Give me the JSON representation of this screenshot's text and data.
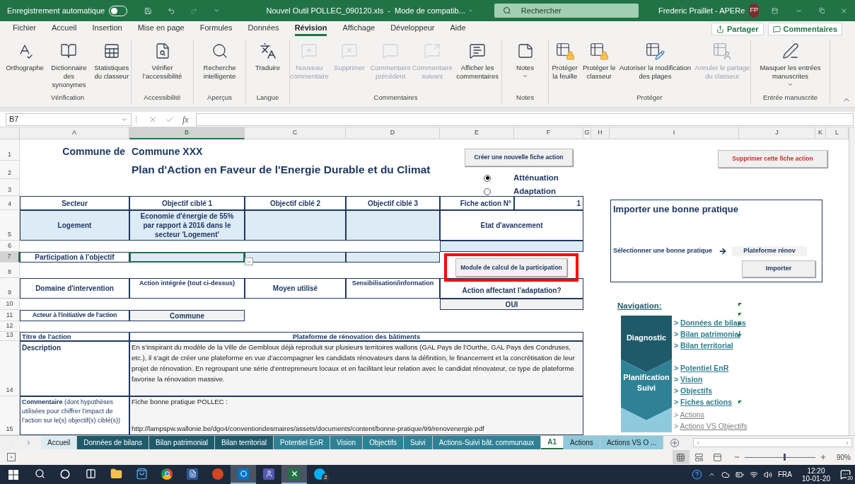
{
  "title_bar": {
    "autosave_label": "Enregistrement automatique",
    "autosave_on": false,
    "document_title": "Nouvel Outil POLLEC_090120.xls  -  Mode de compatib...",
    "search_placeholder": "Rechercher",
    "user_name": "Frederic Praillet - APERe",
    "user_initials": "FP"
  },
  "menu_tabs": [
    {
      "label": "Fichier",
      "selected": false
    },
    {
      "label": "Accueil",
      "selected": false
    },
    {
      "label": "Insertion",
      "selected": false
    },
    {
      "label": "Mise en page",
      "selected": false
    },
    {
      "label": "Formules",
      "selected": false
    },
    {
      "label": "Données",
      "selected": false
    },
    {
      "label": "Révision",
      "selected": true
    },
    {
      "label": "Affichage",
      "selected": false
    },
    {
      "label": "Développeur",
      "selected": false
    },
    {
      "label": "Aide",
      "selected": false
    }
  ],
  "share_buttons": [
    "Partager",
    "Commentaires"
  ],
  "ribbon_groups": [
    {
      "label": "Vérification",
      "commands": [
        {
          "label": "Orthographe",
          "disabled": false,
          "menu": false
        },
        {
          "label": "Dictionnaire des synonymes",
          "disabled": false,
          "menu": false
        },
        {
          "label": "Statistiques du classeur",
          "disabled": false,
          "menu": false
        }
      ]
    },
    {
      "label": "Accessibilité",
      "commands": [
        {
          "label": "Vérifier l’accessibilité",
          "disabled": false,
          "menu": false
        }
      ]
    },
    {
      "label": "Aperçus",
      "commands": [
        {
          "label": "Recherche intelligente",
          "disabled": false,
          "menu": false
        }
      ]
    },
    {
      "label": "Langue",
      "commands": [
        {
          "label": "Traduire",
          "disabled": false,
          "menu": false
        }
      ]
    },
    {
      "label": "Commentaires",
      "commands": [
        {
          "label": "Nouveau commentaire",
          "disabled": true,
          "menu": false
        },
        {
          "label": "Supprimer",
          "disabled": true,
          "menu": false
        },
        {
          "label": "Commentaire précédent",
          "disabled": true,
          "menu": false
        },
        {
          "label": "Commentaire suivant",
          "disabled": true,
          "menu": false
        },
        {
          "label": "Afficher les commentaires",
          "disabled": false,
          "menu": false
        }
      ]
    },
    {
      "label": "Notes",
      "commands": [
        {
          "label": "Notes",
          "disabled": false,
          "menu": true
        }
      ]
    },
    {
      "label": "Protéger",
      "commands": [
        {
          "label": "Protéger la feuille",
          "disabled": false,
          "menu": false
        },
        {
          "label": "Protéger le classeur",
          "disabled": false,
          "menu": false
        },
        {
          "label": "Autoriser la modification des plages",
          "disabled": false,
          "menu": false
        },
        {
          "label": "Annuler le partage du classeur",
          "disabled": true,
          "menu": false
        }
      ]
    },
    {
      "label": "Entrée manuscrite",
      "commands": [
        {
          "label": "Masquer les entrées manuscrites",
          "disabled": false,
          "menu": true
        }
      ]
    }
  ],
  "formula_bar": {
    "name_box": "B7",
    "function_button": "fx"
  },
  "columns": [
    {
      "label": "A",
      "selected": false
    },
    {
      "label": "B",
      "selected": true
    },
    {
      "label": "C",
      "selected": false
    },
    {
      "label": "D",
      "selected": false
    },
    {
      "label": "E",
      "selected": false
    },
    {
      "label": "F",
      "selected": false
    },
    {
      "label": "G",
      "selected": false
    },
    {
      "label": "H",
      "selected": false
    },
    {
      "label": "I",
      "selected": false
    },
    {
      "label": "J",
      "selected": false
    },
    {
      "label": "K",
      "selected": false
    },
    {
      "label": "L",
      "selected": false
    }
  ],
  "rows": [
    {
      "label": "1",
      "selected": false
    },
    {
      "label": "2",
      "selected": false
    },
    {
      "label": "3",
      "selected": false
    },
    {
      "label": "4",
      "selected": false
    },
    {
      "label": "5",
      "selected": false
    },
    {
      "label": "6",
      "selected": false
    },
    {
      "label": "7",
      "selected": true
    },
    {
      "label": "8",
      "selected": false
    },
    {
      "label": "9",
      "selected": false
    },
    {
      "label": "10",
      "selected": false
    },
    {
      "label": "11",
      "selected": false
    },
    {
      "label": "12",
      "selected": false
    },
    {
      "label": "13",
      "selected": false
    },
    {
      "label": "14",
      "selected": false
    },
    {
      "label": "15",
      "selected": false
    }
  ],
  "sheet": {
    "commune_label": "Commune de",
    "commune_value": "Commune XXX",
    "plan_title": "Plan d'Action en Faveur de l'Energie Durable et du Climat",
    "header_cells": [
      "Secteur",
      "Objectif ciblé 1",
      "Objectif ciblé 2",
      "Objectif ciblé 3"
    ],
    "fiche_label": "Fiche action N°",
    "fiche_number": "1",
    "sector": "Logement",
    "objective_1": "Economie d'énergie de 55% par rapport à 2016 dans le secteur 'Logement'",
    "status_label": "Etat d'avancement",
    "participation_label": "Participation à l'objectif",
    "domain_label": "Domaine d'intervention",
    "domain_cells": [
      "Action intégrée (tout ci-dessus)",
      "Moyen utilisé",
      "Sensibilisation/information"
    ],
    "adaptation_label": "Action affectant l'adaptation?",
    "adaptation_value": "OUI",
    "actor_label": "Acteur à l'initiative de l'action",
    "actor_value": "Commune",
    "title_label": "Titre de l'action",
    "title_value": "Plateforme de rénovation des bâtiments",
    "description_label": "Description",
    "description": "En s’inspirant du modèle de la Ville de Gembloux déjà reproduit sur plusieurs territoires wallons (GAL Pays de l’Ourthe, GAL Pays des Condruses, etc.), il s’agit de créer une plateforme en vue d’accompagner les candidats rénovateurs dans la définition, le financement et la concrétisation de leur projet de rénovation. En regroupant une série d’entrepreneurs locaux et en facilitant leur relation avec le candidat rénovateur, ce type de plateforme favorise la rénovation massive.",
    "comment_label": "**Commentaire** (dont hypothèses utilisées pour chiffrer l’impact de l’action sur le(s) objectif(s) ciblé(s))",
    "comment_lines": [
      "Fiche bonne pratique POLLEC :",
      "http://lampspw.wallonie.be/dgo4/conventiondesmaires/assets/documents/content/bonne-pratique/99/renovenergie.pdf"
    ]
  },
  "sheet_buttons": {
    "create": "Créer une nouvelle fiche action",
    "delete": "Supprimer cette fiche action",
    "module": "Module de calcul de la participation"
  },
  "radios": [
    {
      "label": "Atténuation",
      "selected": true
    },
    {
      "label": "Adaptation",
      "selected": false
    }
  ],
  "import_panel": {
    "title": "Importer une bonne pratique",
    "select_label": "Sélectionner une bonne pratique",
    "selected_value": "Plateforme rénov",
    "button": "Importer"
  },
  "navigation": {
    "title": "Navigation:",
    "stages": [
      {
        "label": "Diagnostic",
        "links": [
          {
            "marker": ">",
            "label": "Données de bilans",
            "kind": "bold"
          },
          {
            "marker": ">",
            "label": "Bilan patrimonial",
            "kind": "bold"
          },
          {
            "marker": ">",
            "label": "Bilan territorial",
            "kind": "bold"
          }
        ]
      },
      {
        "label": "Planification Suivi",
        "links": [
          {
            "marker": ">",
            "label": "Potentiel EnR",
            "kind": "bold"
          },
          {
            "marker": ">",
            "label": "Vision",
            "kind": "bold"
          },
          {
            "marker": ">",
            "label": "Objectifs",
            "kind": "bold"
          },
          {
            "marker": ">",
            "label": "Fiches actions",
            "kind": "bold"
          }
        ]
      },
      {
        "links": [
          {
            "marker": ">",
            "label": "Actions",
            "kind": "plain"
          },
          {
            "marker": ">",
            "label": "Actions VS Objectifs",
            "kind": "plain"
          }
        ]
      }
    ]
  },
  "sheet_tabs": [
    {
      "label": "Accueil",
      "color": "#dcecf2",
      "selected": false
    },
    {
      "label": "Données de bilans",
      "color": "#1f5a6b",
      "selected": false
    },
    {
      "label": "Bilan patrimonial",
      "color": "#1f5a6b",
      "selected": false
    },
    {
      "label": "Bilan territorial",
      "color": "#1f5a6b",
      "selected": false
    },
    {
      "label": "Potentiel EnR",
      "color": "#2f8196",
      "selected": false
    },
    {
      "label": "Vision",
      "color": "#2f8196",
      "selected": false
    },
    {
      "label": "Objectifs",
      "color": "#2f8196",
      "selected": false
    },
    {
      "label": "Suivi",
      "color": "#2f8196",
      "selected": false
    },
    {
      "label": "Actions-Suivi bât. communaux",
      "color": "#2f8196",
      "selected": false
    },
    {
      "label": "A1",
      "color": "#ffffff",
      "selected": true
    },
    {
      "label": "Actions",
      "color": "#8ecadc",
      "selected": false
    },
    {
      "label": "Actions VS O ...",
      "color": "#8ecadc",
      "selected": false
    }
  ],
  "status_bar": {
    "views": [
      {
        "kind": "normal",
        "selected": true
      },
      {
        "kind": "page_layout",
        "selected": false
      },
      {
        "kind": "page_break",
        "selected": false
      }
    ],
    "zoom": {
      "level": 0.55,
      "reading": "90%"
    }
  },
  "taskbar": {
    "apps": [
      {
        "kind": "search",
        "active": false
      },
      {
        "kind": "cortana",
        "active": false
      },
      {
        "kind": "taskview",
        "active": false
      },
      {
        "kind": "explorer",
        "active": false
      },
      {
        "kind": "store",
        "active": false
      },
      {
        "kind": "chrome",
        "active": false
      },
      {
        "kind": "word",
        "active": false
      },
      {
        "kind": "powerpoint",
        "active": false
      },
      {
        "kind": "outlook",
        "active": true
      },
      {
        "kind": "teams",
        "active": false
      },
      {
        "kind": "excel",
        "active": true
      },
      {
        "kind": "skype",
        "active": false,
        "badge": "2"
      }
    ],
    "language": "FRA",
    "time": "12:20",
    "date": "10-01-20",
    "notification_count": "20"
  }
}
